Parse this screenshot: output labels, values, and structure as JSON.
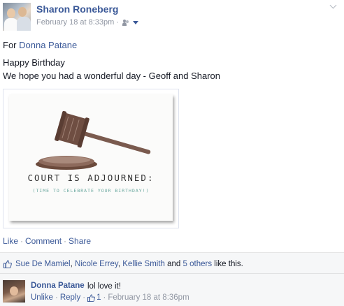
{
  "post": {
    "author": "Sharon Roneberg",
    "timestamp": "February 18 at 8:33pm",
    "meta_separator": "·",
    "privacy_icon": "friends-icon",
    "for_prefix": "For",
    "for_name": "Donna Patane",
    "message_line1": "Happy Birthday",
    "message_line2": "We hope you had a wonderful day - Geoff and Sharon",
    "card_title": "COURT IS ADJOURNED:",
    "card_subtitle": "(TIME TO CELEBRATE YOUR BIRTHDAY!)"
  },
  "actions": {
    "like": "Like",
    "comment": "Comment",
    "share": "Share",
    "sep": "·"
  },
  "likes": {
    "name1": "Sue De Mamiel",
    "name2": "Nicole Errey",
    "name3": "Kellie Smith",
    "comma": ",",
    "and": "and",
    "others": "5 others",
    "suffix": "like this."
  },
  "comment": {
    "author": "Donna Patane",
    "text": "lol love it!",
    "unlike": "Unlike",
    "reply": "Reply",
    "sep": "·",
    "like_count": "1",
    "timestamp": "February 18 at 8:36pm"
  },
  "colors": {
    "link": "#3b5998",
    "meta": "#9197a3",
    "panel": "#f6f7f8"
  }
}
